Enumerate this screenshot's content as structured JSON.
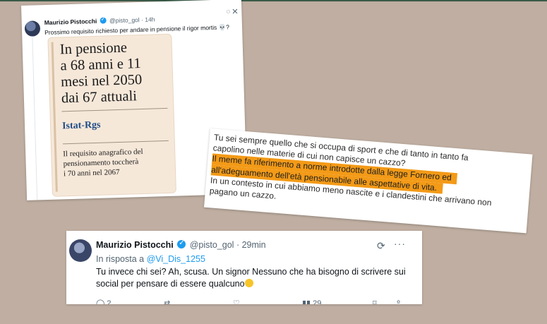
{
  "tweet1": {
    "author": "Maurizio Pistocchi",
    "handle": "@pisto_gol",
    "time": "· 14h",
    "text": "Prossimo requisito richiesto per andare in pensione il rigor mortis 💀?",
    "image": {
      "headline": "In pensione\na 68 anni e 11\nmesi nel 2050\ndai 67 attuali",
      "source": "Istat-Rgs",
      "subtext": "Il requisito anagrafico del\npensionamento toccherà\ni 70 anni nel 2067"
    },
    "icons": [
      "grok-icon",
      "close-icon"
    ]
  },
  "reply_card": {
    "lines": [
      "Tu sei sempre quello che si occupa di sport e che di tanto in tanto fa",
      "capolino nelle materie di cui non capisce un cazzo?",
      "Il meme fa riferimento a norme introdotte dalla legge Fornero ed",
      "all'adeguamento dell'età pensionabile alle aspettative di vita.",
      "In un contesto in cui abbiamo meno nascite e i clandestini che arrivano non",
      "pagano un cazzo."
    ],
    "highlight_color": "#f39a17"
  },
  "tweet2": {
    "author": "Maurizio Pistocchi",
    "handle": "@pisto_gol",
    "time": "· 29min",
    "reply_prefix": "In risposta a",
    "reply_to": "@Vi_Dis_1255",
    "text": "Tu invece chi sei? Ah, scusa. Un signor Nessuno che ha bisogno di scrivere sui social per pensare di essere qualcuno",
    "emoji": "rolling-on-floor-laughing",
    "more": "···",
    "replies": "2",
    "views": "29"
  },
  "colors": {
    "background": "#bfaea1",
    "link": "#1d9bf0",
    "source": "#1f4c86"
  }
}
